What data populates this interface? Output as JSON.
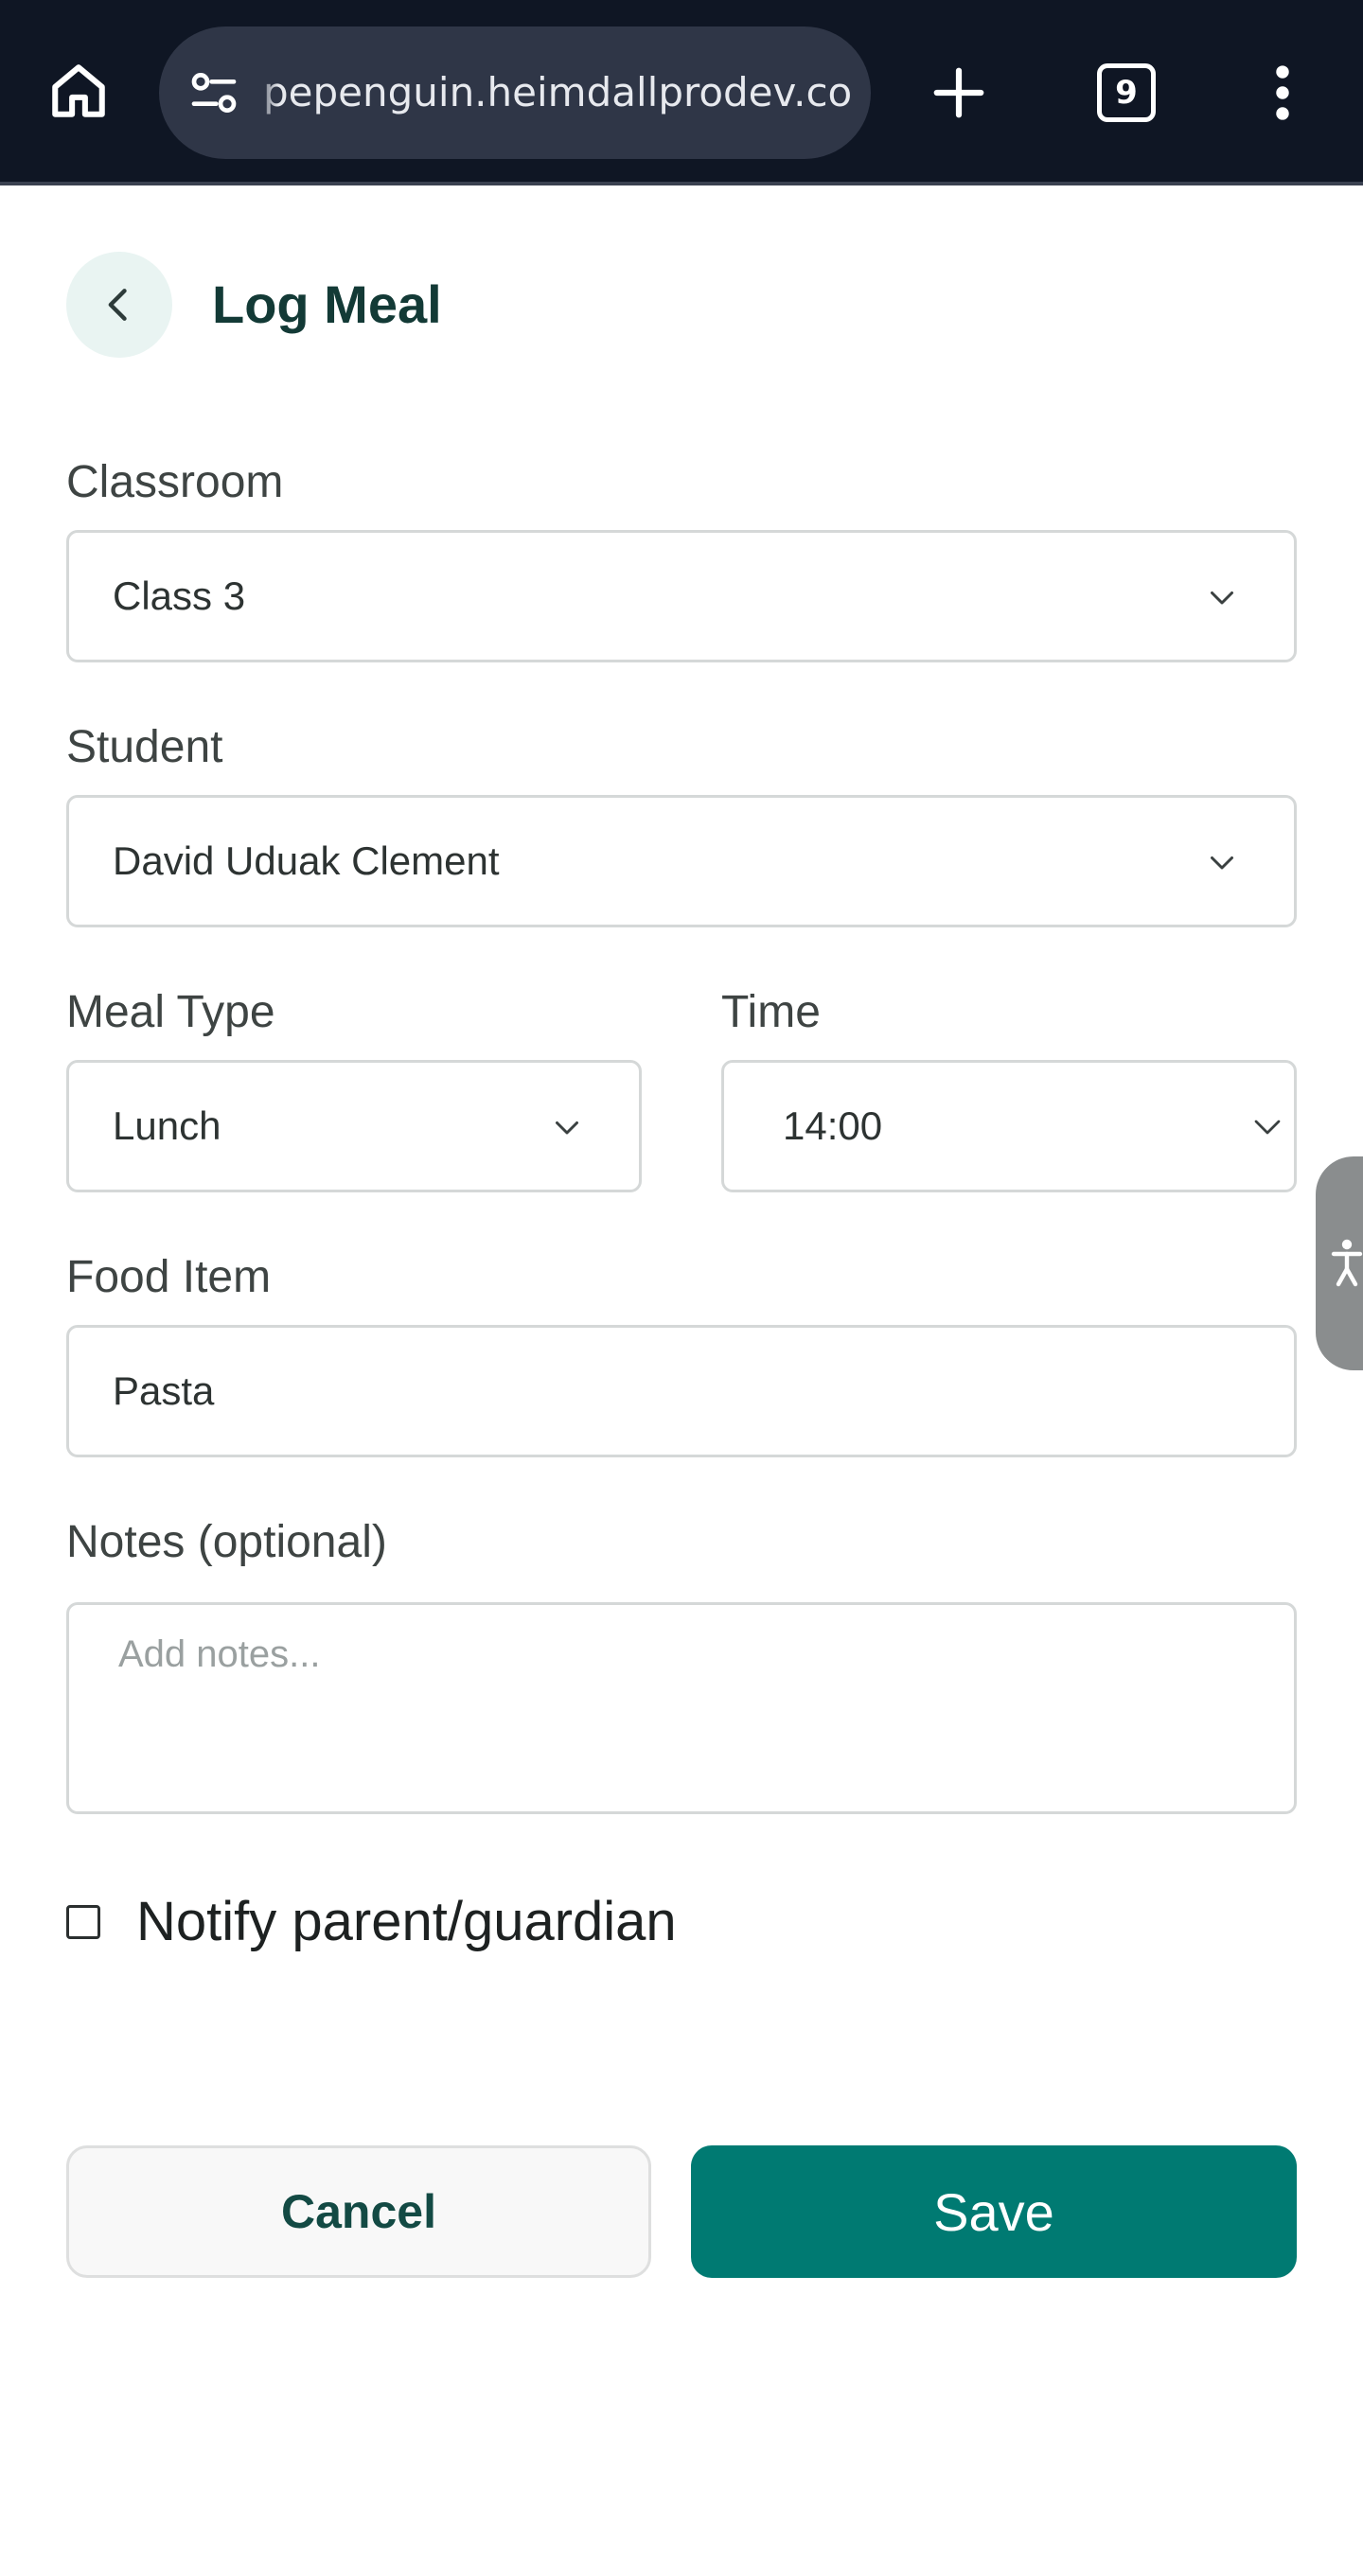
{
  "browser": {
    "url": "pepenguin.heimdallprodev.com",
    "tab_count": "9",
    "icons": {
      "home": "home-icon",
      "site_settings": "tune-icon",
      "new_tab": "plus-icon",
      "menu": "more-vert-icon"
    }
  },
  "page": {
    "title": "Log Meal",
    "back_icon": "chevron-left-icon"
  },
  "form": {
    "classroom": {
      "label": "Classroom",
      "value": "Class 3"
    },
    "student": {
      "label": "Student",
      "value": "David Uduak Clement"
    },
    "meal_type": {
      "label": "Meal Type",
      "value": "Lunch"
    },
    "time": {
      "label": "Time",
      "value": "14:00"
    },
    "food_item": {
      "label": "Food Item",
      "value": "Pasta"
    },
    "notes": {
      "label": "Notes (optional)",
      "placeholder": "Add notes...",
      "value": ""
    },
    "notify": {
      "label": "Notify parent/guardian",
      "checked": false
    }
  },
  "actions": {
    "cancel_label": "Cancel",
    "save_label": "Save"
  },
  "colors": {
    "primary": "#007a72",
    "title": "#133a36",
    "topbar": "#0f1624"
  }
}
